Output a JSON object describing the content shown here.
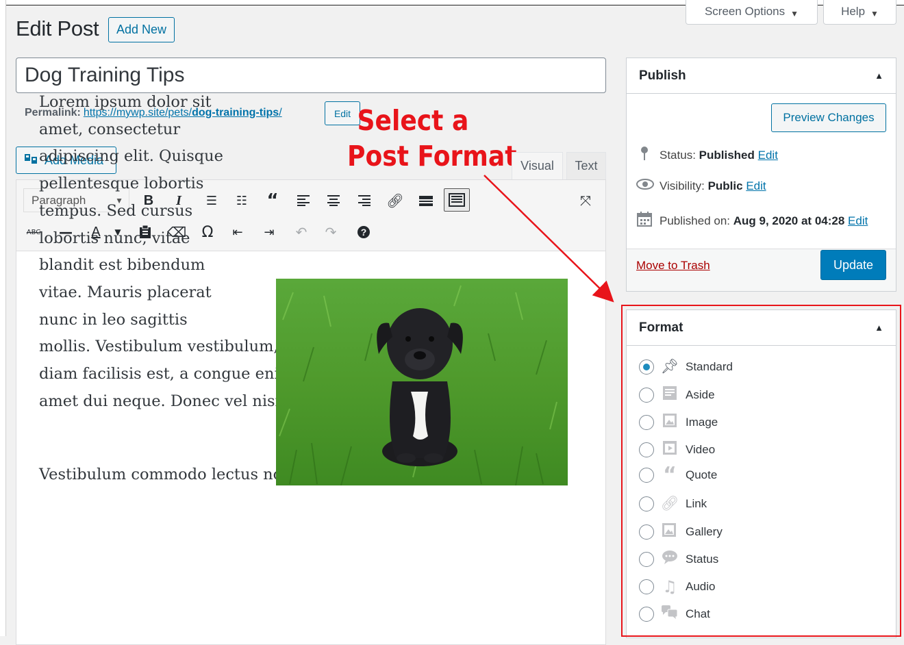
{
  "header": {
    "title": "Edit Post",
    "add_new": "Add New",
    "screen_options": "Screen Options",
    "help": "Help"
  },
  "post": {
    "title": "Dog Training Tips",
    "permalink_label": "Permalink:",
    "permalink_base": "https://mywp.site/pets/",
    "permalink_slug": "dog-training-tips",
    "permalink_end": "/",
    "permalink_edit": "Edit"
  },
  "annotation": {
    "line1": "Select a",
    "line2": "Post Format"
  },
  "editor": {
    "add_media": "Add Media",
    "tab_visual": "Visual",
    "tab_text": "Text",
    "format_select": "Paragraph",
    "float_text": "Lorem ipsum dolor sit amet, consectetur adipiscing elit. Quisque pellentesque lobortis tempus. Sed cursus lobortis nunc, vitae blandit est bibendum vitae. Mauris placerat nunc in leo sagittis",
    "continued_lines": [
      "mollis. Vestibulum vestibulum, nunc nec venenatis sagittis, lacus",
      "diam facilisis est, a congue enim neque nec orci. Pellentesque sit",
      "amet dui neque. Donec vel nisi magna. Fusce nec faucibus ipsum."
    ],
    "para2": "Vestibulum commodo lectus non mi iaculis, in molestie ipsum."
  },
  "publish": {
    "heading": "Publish",
    "preview": "Preview Changes",
    "status_label": "Status:",
    "status_value": "Published",
    "visibility_label": "Visibility:",
    "visibility_value": "Public",
    "published_label": "Published on:",
    "published_value": "Aug 9, 2020 at 04:28",
    "edit": "Edit",
    "trash": "Move to Trash",
    "update": "Update"
  },
  "format": {
    "heading": "Format",
    "options": [
      {
        "label": "Standard",
        "icon": "pin-icon",
        "checked": true
      },
      {
        "label": "Aside",
        "icon": "aside-icon",
        "checked": false
      },
      {
        "label": "Image",
        "icon": "image-icon",
        "checked": false
      },
      {
        "label": "Video",
        "icon": "video-icon",
        "checked": false
      },
      {
        "label": "Quote",
        "icon": "quote-icon",
        "checked": false
      },
      {
        "label": "Link",
        "icon": "link-icon",
        "checked": false
      },
      {
        "label": "Gallery",
        "icon": "gallery-icon",
        "checked": false
      },
      {
        "label": "Status",
        "icon": "status-icon",
        "checked": false
      },
      {
        "label": "Audio",
        "icon": "audio-icon",
        "checked": false
      },
      {
        "label": "Chat",
        "icon": "chat-icon",
        "checked": false
      }
    ]
  },
  "colors": {
    "accent": "#0071a1",
    "primary_button": "#007cba",
    "annotation": "#e8141a",
    "trash": "#aa0000"
  }
}
